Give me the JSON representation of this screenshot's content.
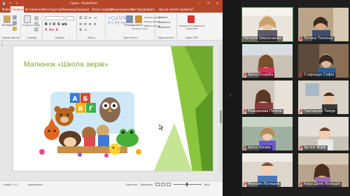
{
  "window": {
    "title": "Грамо - PowerPoint",
    "app": "PowerPoint",
    "controls": "— ❐ ✕"
  },
  "menu": {
    "tabs": [
      "Файл",
      "Головна",
      "Вставлення",
      "Конструктор",
      "Переходи",
      "Анімація",
      "Показ слайдів",
      "Рецензування",
      "Вигляд",
      "Довідка",
      "Що ви хочете зробити?"
    ]
  },
  "ribbon": {
    "groups": [
      "Буфер обміну",
      "Слайди",
      "Шрифт",
      "Абзац",
      "Креслення",
      "Редагування",
      "Adobe PDF"
    ],
    "paste_label": "Вставити",
    "new_slide_label": "Створити слайд",
    "arrange_label": "Упорядкувати",
    "quick_styles_label": "Експрес-стилі",
    "fill_label": "Заливка фігури",
    "outline_label": "Контур фігури",
    "effects_label": "Ефекти фігури",
    "find_label": "Знайти",
    "replace_label": "Замінити",
    "select_label": "Виділити",
    "pdf_label": "Створити й поділитися Adobe PDF"
  },
  "slides_panel": {
    "current_slide_number": "1"
  },
  "slide": {
    "title": "Малюнок «Школа звірів»"
  },
  "status": {
    "slide_of": "Слайд 1 з 1",
    "language": "українська",
    "notes": "Нотатки",
    "comments": "Примітки",
    "zoom": "64%"
  },
  "participants": [
    {
      "name": "Наталія Омельченко",
      "mic": false,
      "speaking": true
    },
    {
      "name": "Тетяна Топольк",
      "mic": true,
      "speaking": false
    },
    {
      "name": "Аріна Коцюба",
      "mic": true,
      "speaking": false
    },
    {
      "name": "Старощук Софія",
      "mic": true,
      "speaking": false
    },
    {
      "name": "Майданова Поліна",
      "mic": true,
      "speaking": false
    },
    {
      "name": "Григорьев Тимур",
      "mic": true,
      "speaking": false
    },
    {
      "name": "Аріна Бікова",
      "mic": true,
      "speaking": false
    },
    {
      "name": "Артем Янюк",
      "mic": true,
      "speaking": false
    },
    {
      "name": "Максим Латишев",
      "mic": true,
      "speaking": false
    },
    {
      "name": "Кира Деніс Колодій",
      "mic": true,
      "speaking": false
    }
  ],
  "colors": {
    "ppt_brand": "#b7472a",
    "title_green": "#7fa534",
    "active_speaker": "#2d8c3c",
    "mic_muted": "#e02f2f"
  }
}
